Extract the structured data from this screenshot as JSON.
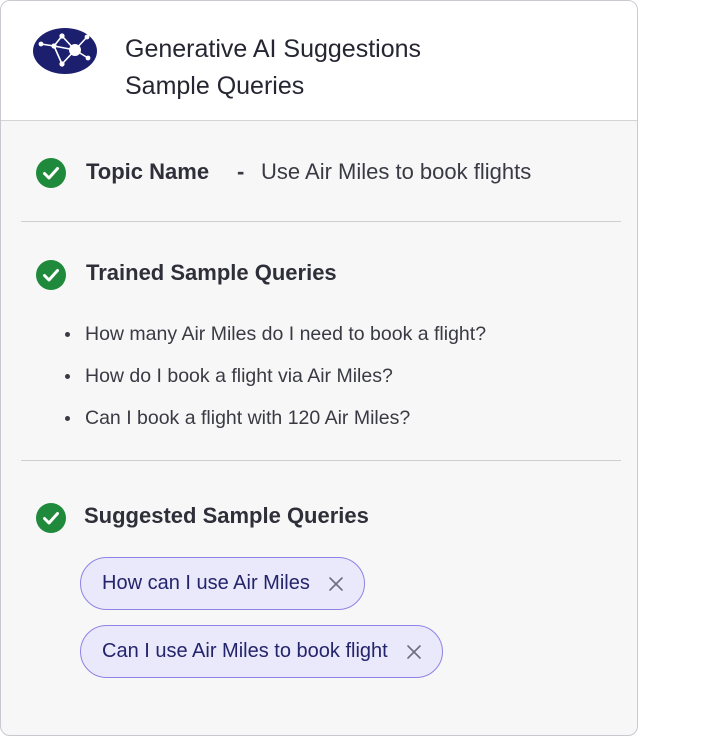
{
  "header": {
    "title_line1": "Generative AI Suggestions",
    "title_line2": "Sample Queries",
    "logo_icon": "network-nodes-icon"
  },
  "topic": {
    "label": "Topic Name",
    "separator": "-",
    "value": "Use Air Miles to book flights"
  },
  "trained": {
    "heading": "Trained Sample Queries",
    "items": [
      "How many Air Miles do I need to book a flight?",
      "How do I book a flight via Air Miles?",
      "Can I book a flight with 120 Air Miles?"
    ]
  },
  "suggested": {
    "heading": "Suggested Sample Queries",
    "chips": [
      "How can I use Air Miles",
      "Can I use Air Miles to book flight"
    ]
  },
  "colors": {
    "check_green": "#1f8a3b",
    "logo_navy": "#1c1f6e",
    "chip_border": "#8f82e6",
    "chip_bg": "#eae8fb"
  }
}
